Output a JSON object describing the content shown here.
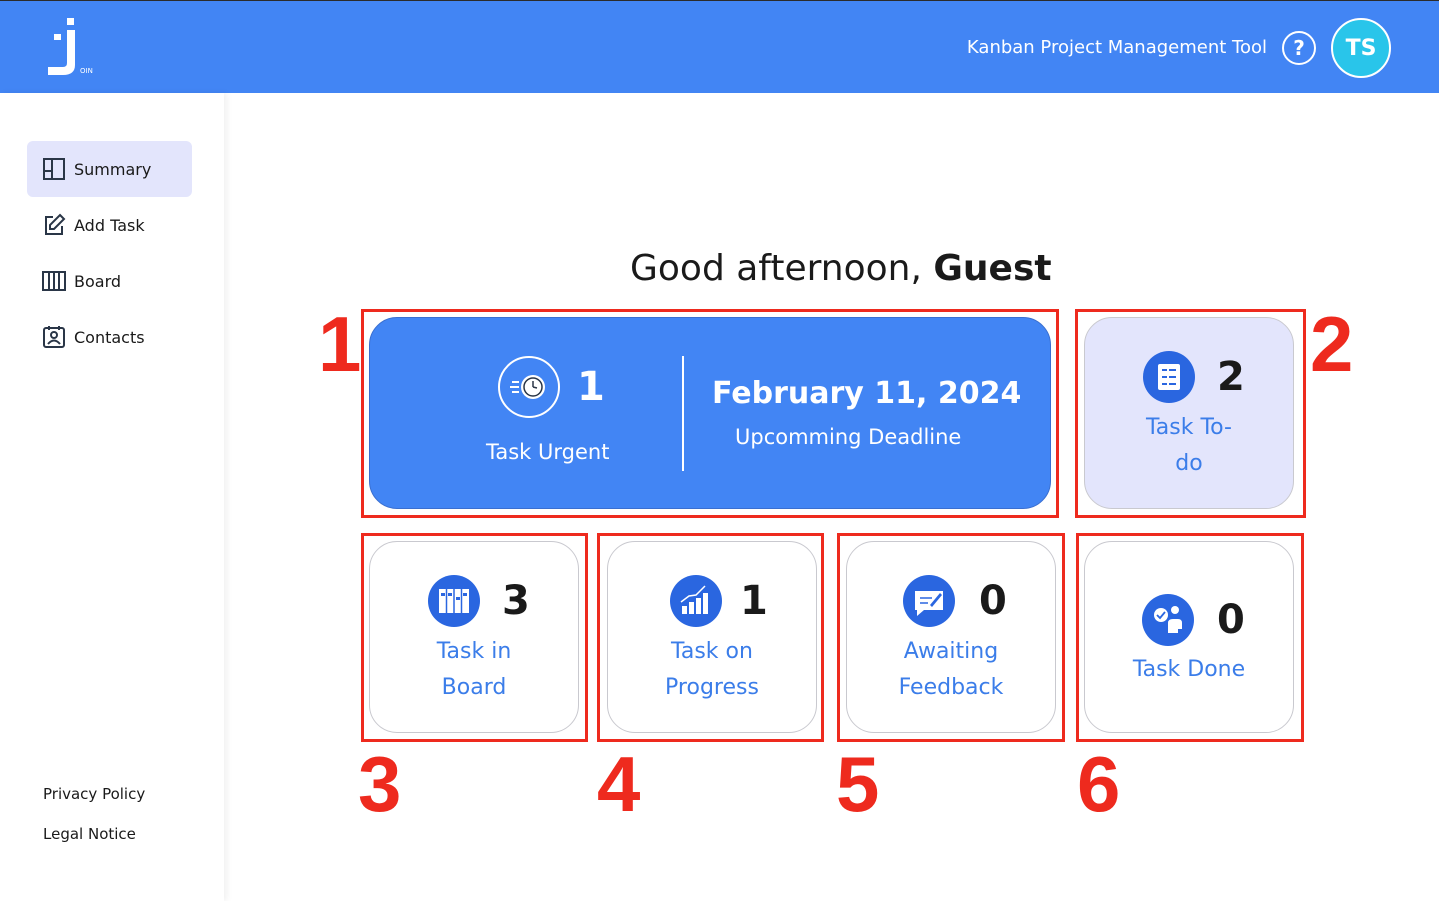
{
  "header": {
    "title": "Kanban Project Management Tool",
    "help_label": "?",
    "avatar_initials": "TS",
    "logo_text": "OIN"
  },
  "sidebar": {
    "items": [
      {
        "label": "Summary",
        "icon": "summary-icon",
        "active": true
      },
      {
        "label": "Add Task",
        "icon": "edit-icon"
      },
      {
        "label": "Board",
        "icon": "board-icon"
      },
      {
        "label": "Contacts",
        "icon": "contacts-icon"
      }
    ],
    "footer": {
      "privacy": "Privacy Policy",
      "legal": "Legal Notice"
    }
  },
  "main": {
    "greeting_prefix": "Good afternoon,",
    "greeting_name": "Guest",
    "urgent": {
      "count": "1",
      "label": "Task Urgent",
      "deadline_date": "February 11, 2024",
      "deadline_label": "Upcomming Deadline"
    },
    "cards": [
      {
        "count": "2",
        "label_line1": "Task To-",
        "label_line2": "do",
        "icon": "todo-icon"
      },
      {
        "count": "3",
        "label_line1": "Task in",
        "label_line2": "Board",
        "icon": "board-columns-icon"
      },
      {
        "count": "1",
        "label_line1": "Task on",
        "label_line2": "Progress",
        "icon": "progress-chart-icon"
      },
      {
        "count": "0",
        "label_line1": "Awaiting",
        "label_line2": "Feedback",
        "icon": "feedback-icon"
      },
      {
        "count": "0",
        "label_line1": "Task Done",
        "icon": "done-icon"
      }
    ]
  },
  "annotations": [
    "1",
    "2",
    "3",
    "4",
    "5",
    "6"
  ],
  "colors": {
    "header": "#4285f4",
    "active_nav": "#e3e5fc",
    "avatar": "#29c5ea",
    "card_label": "#3b7de9",
    "annotation": "#ee2a1e"
  }
}
